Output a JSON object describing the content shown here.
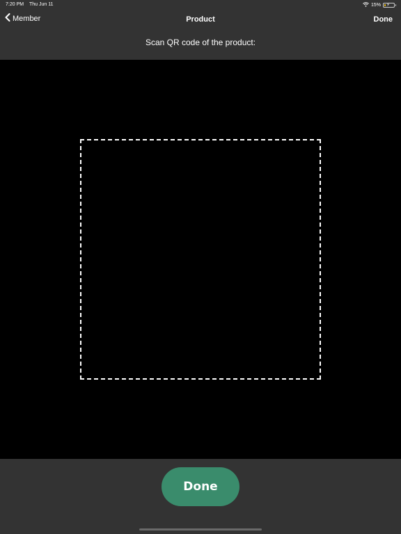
{
  "status_bar": {
    "time": "7:20 PM",
    "date": "Thu Jun 11",
    "wifi_icon": "wifi-icon",
    "battery_percent": "15%",
    "battery_level": 0.15,
    "battery_icon": "battery-charging-icon"
  },
  "nav": {
    "back_label": "Member",
    "back_icon": "chevron-left-icon",
    "title": "Product",
    "done_label": "Done"
  },
  "scanner": {
    "instruction": "Scan QR code of the product:"
  },
  "footer": {
    "done_label": "Done"
  },
  "colors": {
    "background": "#333333",
    "camera": "#000000",
    "accent": "#3a8c6c",
    "battery_fill": "#f5c518"
  }
}
